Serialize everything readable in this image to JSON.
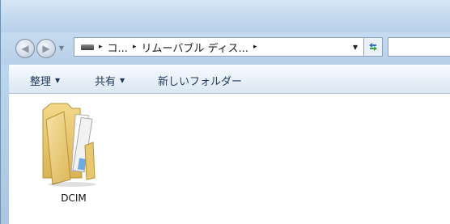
{
  "navigation": {
    "back_icon": "back-arrow-icon",
    "forward_icon": "forward-arrow-icon",
    "history_icon": "chevron-down-icon"
  },
  "address_bar": {
    "drive_icon": "removable-drive-icon",
    "separator": "▸",
    "crumbs": [
      "コ...",
      "リムーバブル ディス..."
    ],
    "dropdown_icon": "chevron-down-icon",
    "refresh_icon": "refresh-icon"
  },
  "search": {
    "placeholder": ""
  },
  "toolbar": {
    "organize_label": "整理",
    "share_label": "共有",
    "new_folder_label": "新しいフォルダー",
    "caret": "▼"
  },
  "content": {
    "items": [
      {
        "label": "DCIM",
        "icon": "folder-icon"
      }
    ]
  },
  "colors": {
    "frame": "#b9d3ec",
    "toolbar_text": "#1e395b",
    "folder": "#e9c96a"
  }
}
